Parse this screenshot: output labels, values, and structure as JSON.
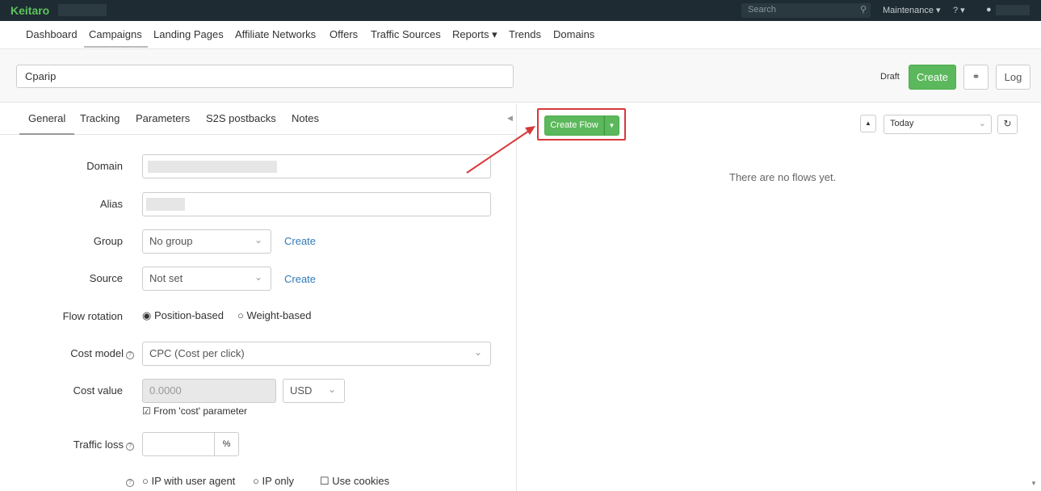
{
  "topbar": {
    "brand": "Keitaro",
    "search_placeholder": "Search",
    "maintenance": "Maintenance ▾",
    "help": "? ▾",
    "user_icon": "▲"
  },
  "nav": {
    "items": [
      "Dashboard",
      "Campaigns",
      "Landing Pages",
      "Affiliate Networks",
      "Offers",
      "Traffic Sources",
      "Reports ▾",
      "Trends",
      "Domains"
    ],
    "active": "Campaigns"
  },
  "campaign": {
    "name": "Cparip",
    "status": "Draft",
    "create_label": "Create",
    "log_label": "Log"
  },
  "tabs": [
    "General",
    "Tracking",
    "Parameters",
    "S2S postbacks",
    "Notes"
  ],
  "form": {
    "domain_label": "Domain",
    "alias_label": "Alias",
    "group_label": "Group",
    "group_value": "No group",
    "group_create": "Create",
    "source_label": "Source",
    "source_value": "Not set",
    "source_create": "Create",
    "flow_rotation_label": "Flow rotation",
    "rotation_options": [
      "Position-based",
      "Weight-based"
    ],
    "cost_model_label": "Cost model",
    "cost_model_value": "CPC (Cost per click)",
    "cost_value_label": "Cost value",
    "cost_value_placeholder": "0.0000",
    "currency_value": "USD",
    "cost_param_checkbox": "From 'cost' parameter",
    "traffic_loss_label": "Traffic loss",
    "traffic_loss_unit": "%",
    "uniqueness_options": [
      "IP with user agent",
      "IP only",
      "Use cookies"
    ]
  },
  "flows": {
    "create_flow_label": "Create Flow",
    "period_value": "Today",
    "empty_text": "There are no flows yet."
  },
  "colors": {
    "brand_green": "#5cb85c",
    "highlight_red": "#d9383a",
    "topbar_bg": "#1e2b33"
  }
}
